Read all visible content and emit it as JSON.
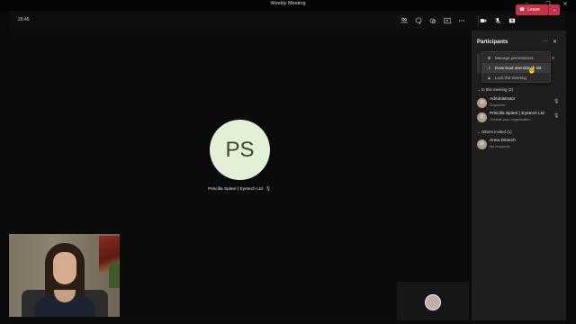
{
  "window": {
    "title": "Weekly Meeting"
  },
  "toolbar": {
    "timer": "26:45",
    "icons": [
      "people-icon",
      "chat-icon",
      "react-icon",
      "share-tray-icon",
      "more-icon",
      "camera-icon",
      "mic-off-icon",
      "share-screen-icon"
    ],
    "leave_label": "Leave",
    "leave_color": "#c4314b"
  },
  "stage": {
    "main_avatar_initials": "PS",
    "main_name": "Priscilla Spiteri | Eyetech Ltd",
    "avatar_bg": "#e4efd8"
  },
  "panel": {
    "title": "Participants",
    "menu": [
      {
        "label": "Manage permissions",
        "icon": "gear-icon"
      },
      {
        "label": "Download attendance list",
        "icon": "download-icon"
      },
      {
        "label": "Lock the meeting",
        "icon": "lock-icon"
      }
    ],
    "in_meeting_header": "In this meeting (2)",
    "participants": [
      {
        "name": "Administrator",
        "subtitle": "Organizer"
      },
      {
        "name": "Priscilla Spiteri | Eyetech Ltd",
        "subtitle": "Outside your organization"
      }
    ],
    "others_header": "Others invited (1)",
    "invited": [
      {
        "name": "Anna Dimech",
        "subtitle": "No response"
      }
    ]
  }
}
